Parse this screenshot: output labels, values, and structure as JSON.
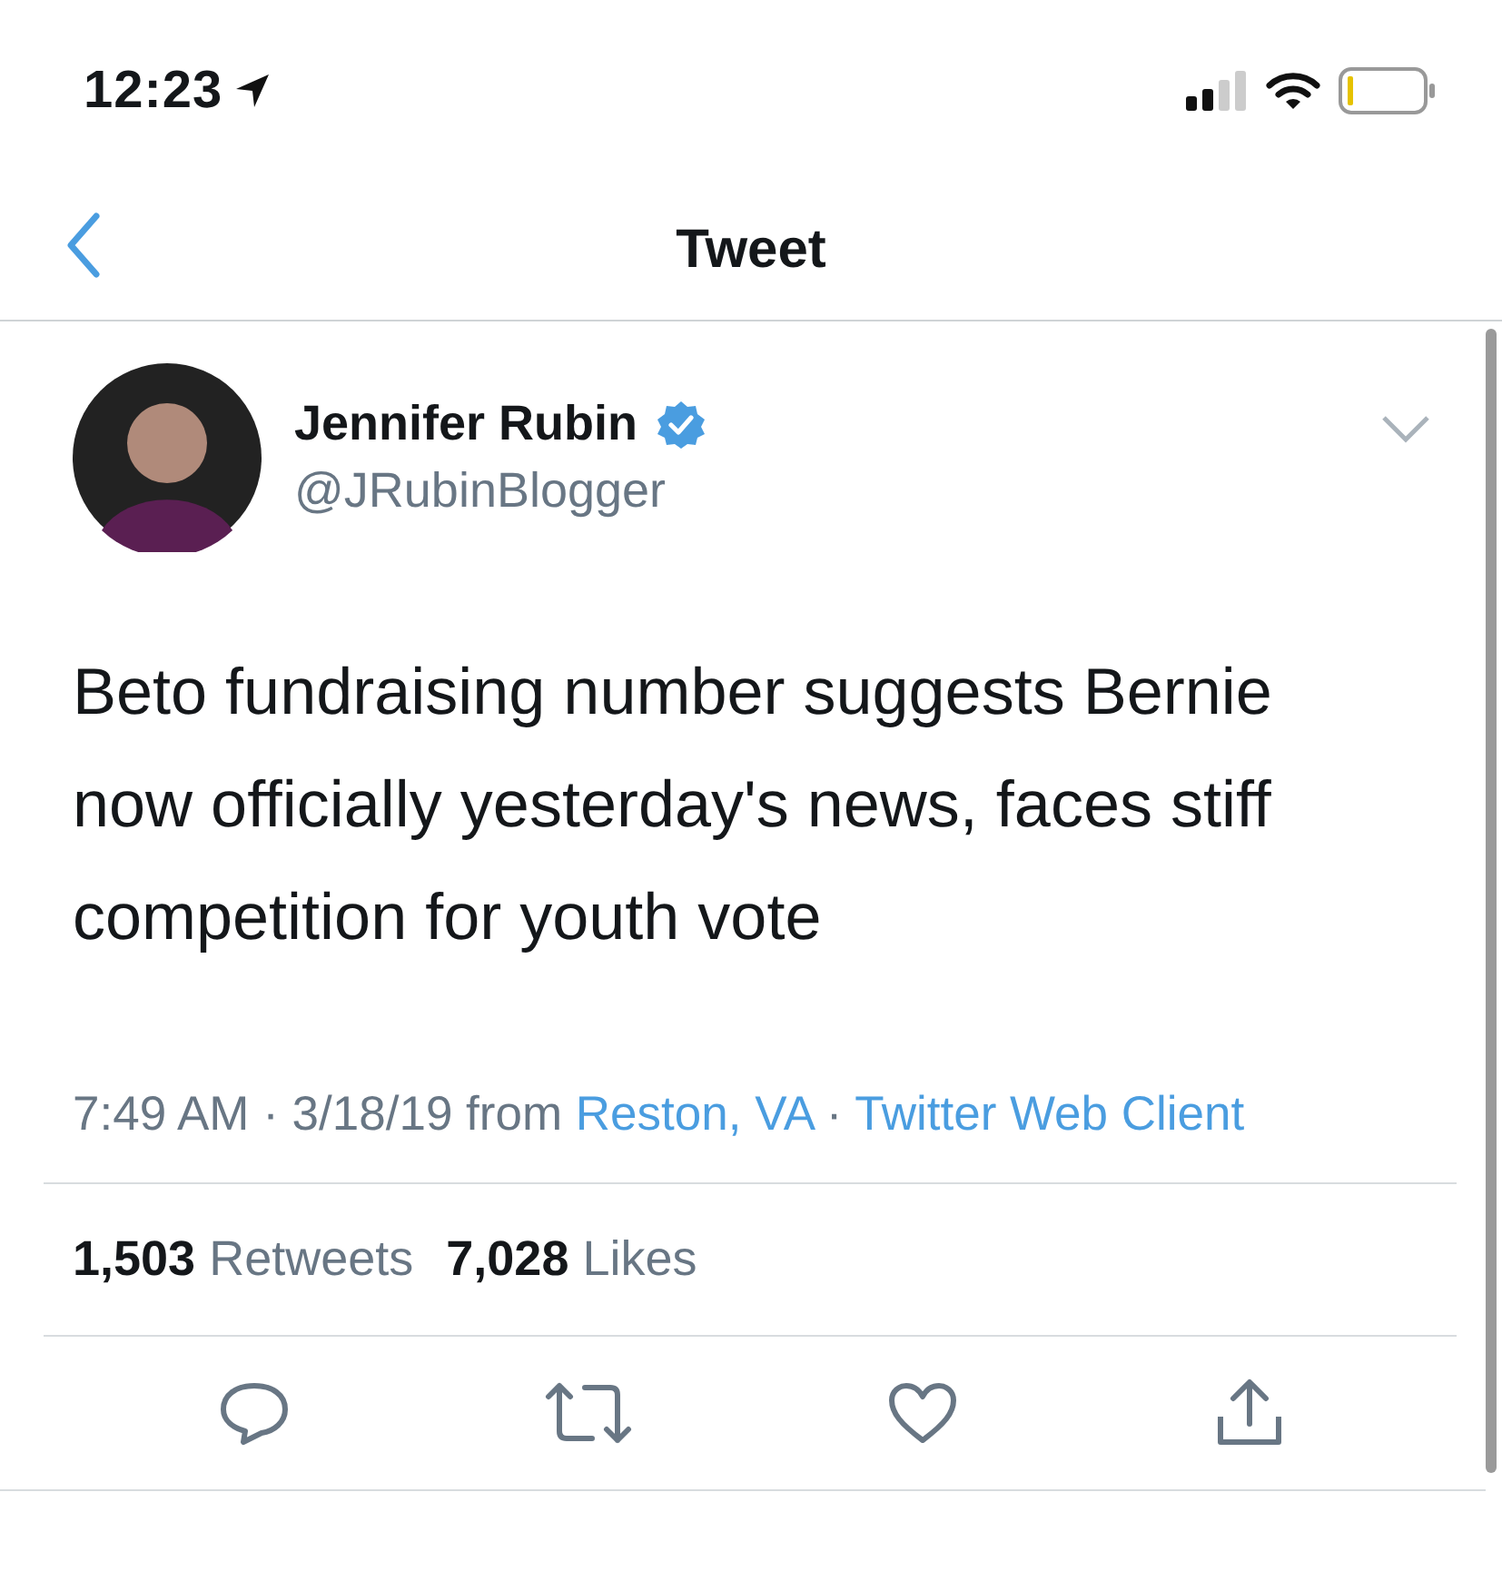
{
  "status_bar": {
    "time": "12:23",
    "location_on": true
  },
  "nav": {
    "title": "Tweet"
  },
  "tweet": {
    "author": {
      "name": "Jennifer Rubin",
      "verified": true,
      "handle": "@JRubinBlogger"
    },
    "text": "Beto fundraising number suggests Bernie now officially yesterday's news, faces stiff competition for youth vote",
    "meta": {
      "timestamp": "7:49 AM · 3/18/19 from",
      "location": "Reston, VA",
      "separator": "·",
      "client": "Twitter Web Client"
    },
    "stats": [
      {
        "text": "**1,503** Retweets"
      },
      {
        "text": "**7,028** Likes"
      }
    ],
    "actions": [
      {
        "kind": "reply"
      },
      {
        "kind": "retweet"
      },
      {
        "kind": "like"
      },
      {
        "kind": "share"
      }
    ]
  }
}
